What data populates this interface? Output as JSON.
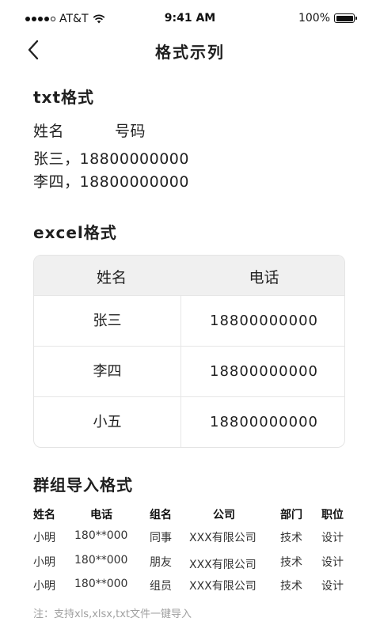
{
  "status_bar": {
    "carrier": "AT&T",
    "time": "9:41 AM",
    "battery": "100%"
  },
  "nav": {
    "title": "格式示列"
  },
  "txt_section": {
    "title": "txt格式",
    "header_name": "姓名",
    "header_phone": "号码",
    "lines": [
      "张三，18800000000",
      "李四，18800000000"
    ]
  },
  "excel_section": {
    "title": "excel格式",
    "columns": [
      "姓名",
      "电话"
    ],
    "rows": [
      [
        "张三",
        "18800000000"
      ],
      [
        "李四",
        "18800000000"
      ],
      [
        "小五",
        "18800000000"
      ]
    ]
  },
  "group_section": {
    "title": "群组导入格式",
    "columns": [
      "姓名",
      "电话",
      "组名",
      "公司",
      "部门",
      "职位"
    ],
    "rows": [
      [
        "小明",
        "180**000",
        "同事",
        "XXX有限公司",
        "技术",
        "设计"
      ],
      [
        "小明",
        "180**000",
        "朋友",
        "XXX有限公司",
        "技术",
        "设计"
      ],
      [
        "小明",
        "180**000",
        "组员",
        "XXX有限公司",
        "技术",
        "设计"
      ]
    ]
  },
  "note": "注：支持xls,xlsx,txt文件一键导入"
}
